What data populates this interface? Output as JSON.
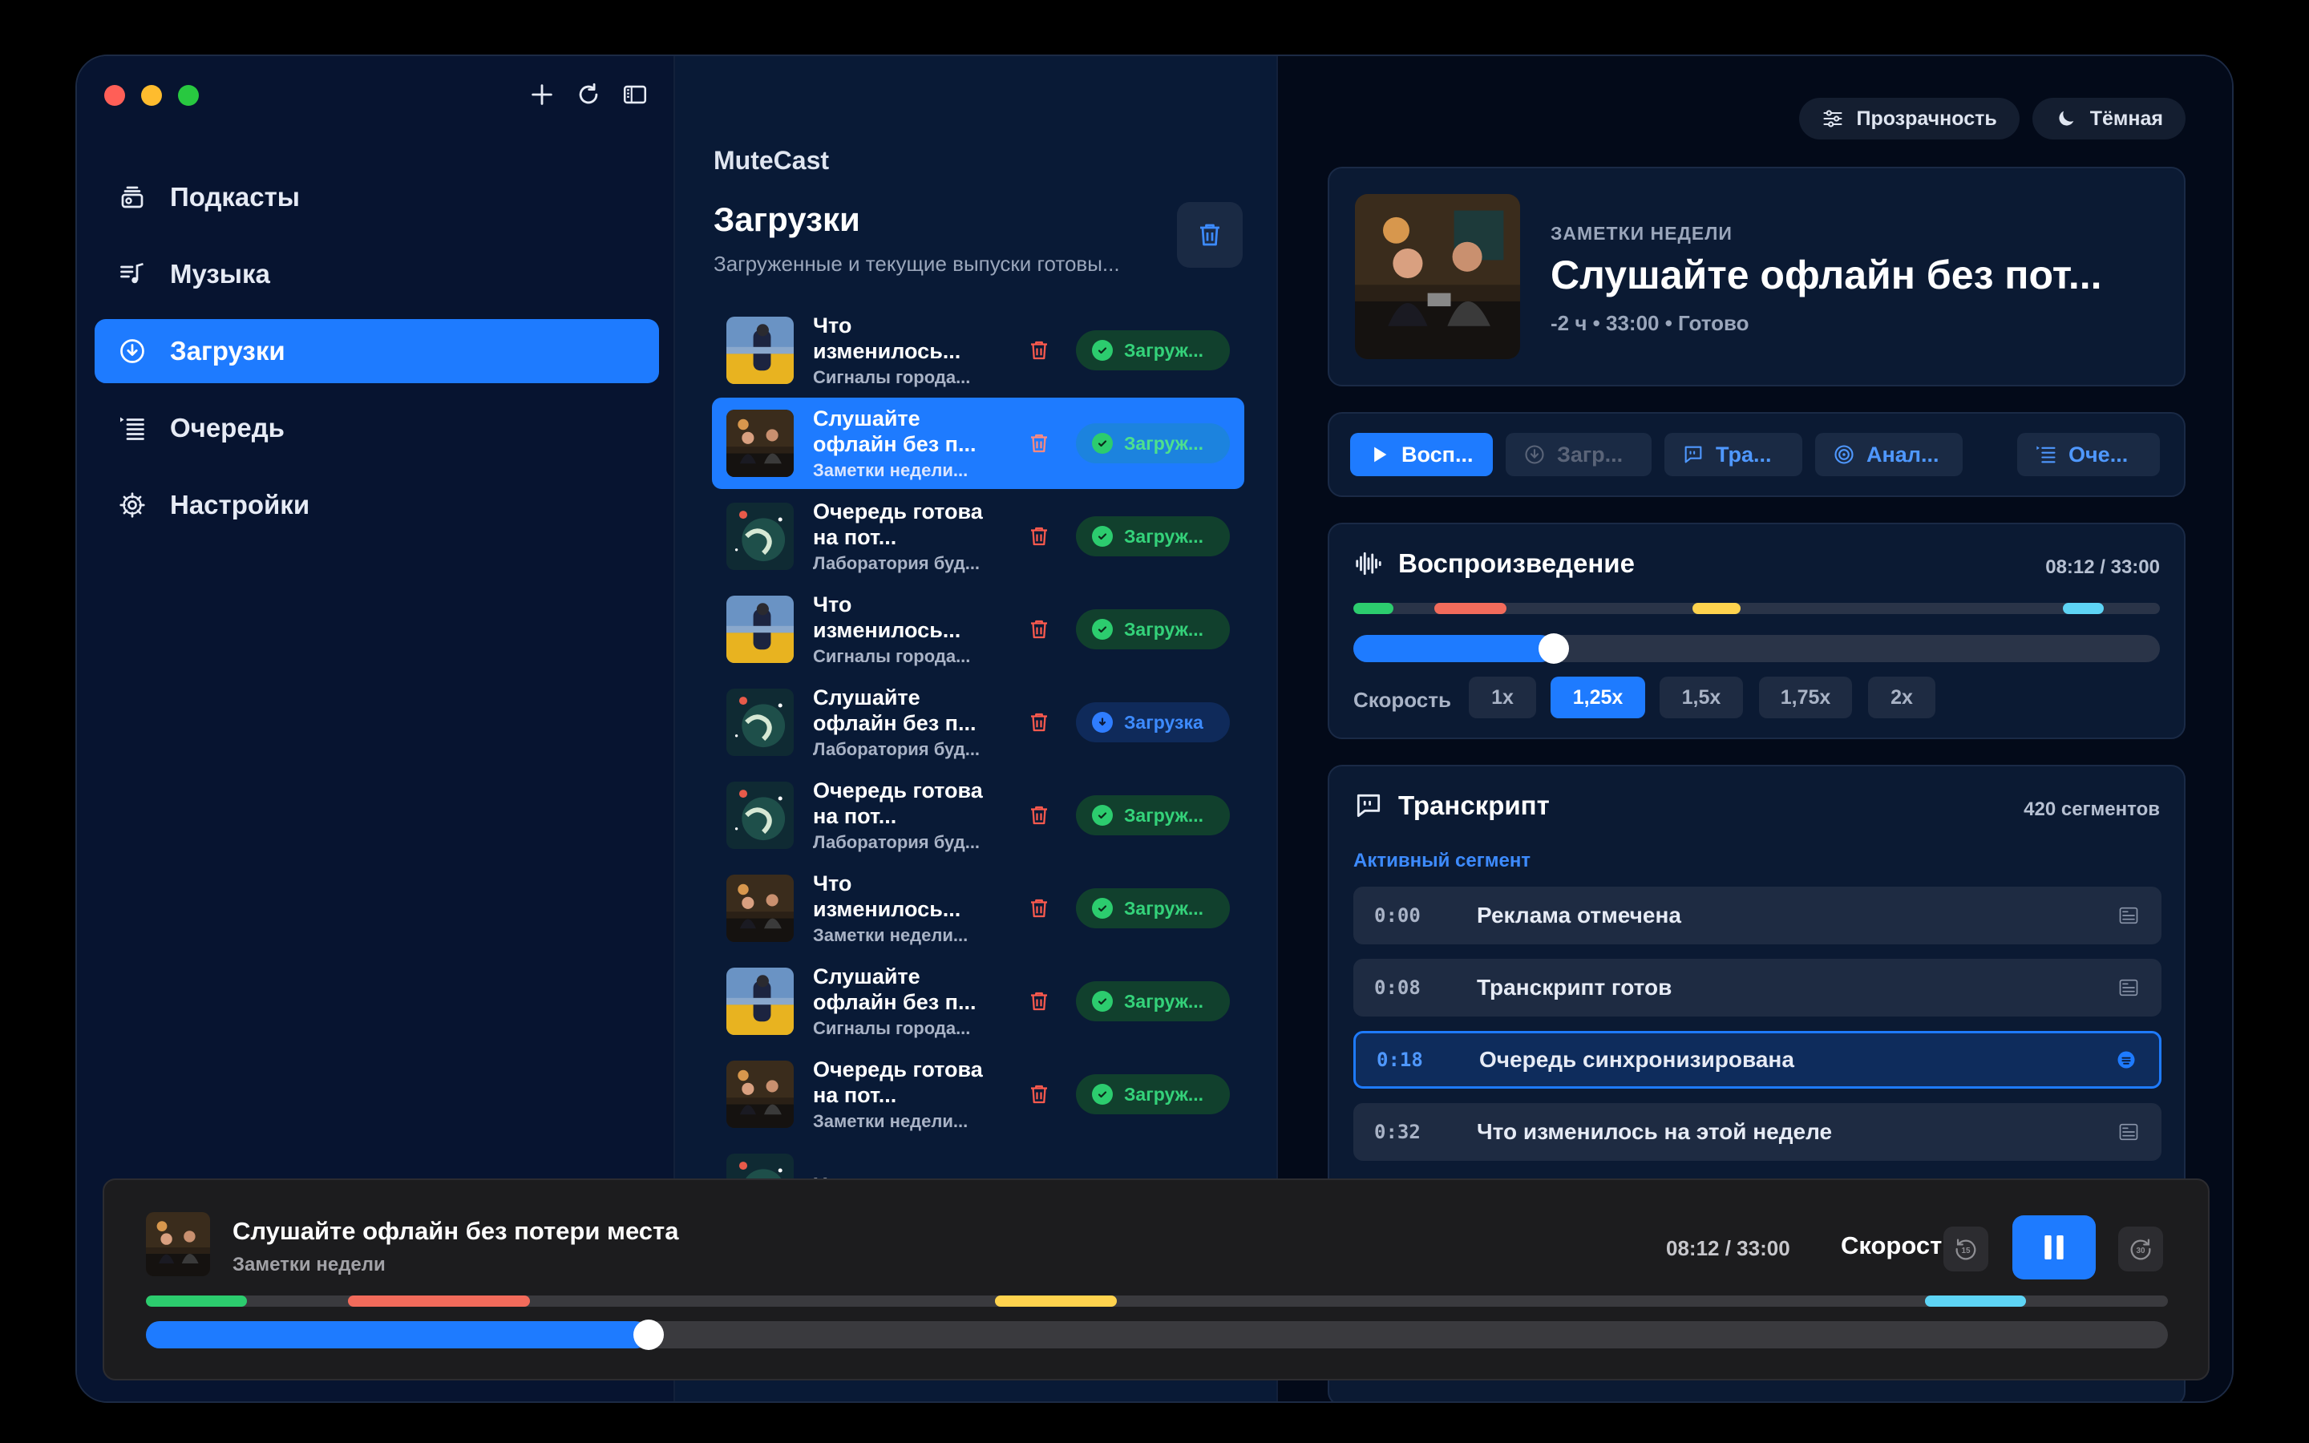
{
  "colors": {
    "accent": "#1e7bff",
    "success": "#34d27a",
    "danger": "#ff5a4e",
    "chapter_green": "#2ccc6e",
    "chapter_red": "#f26b5b",
    "chapter_yellow": "#ffd34e",
    "chapter_cyan": "#5ed4f5"
  },
  "sidebar": {
    "tools": [
      "plus-icon",
      "refresh-icon",
      "sidebar-toggle-icon"
    ],
    "items": [
      {
        "label": "Подкасты",
        "icon": "podcasts-icon",
        "active": false
      },
      {
        "label": "Музыка",
        "icon": "music-icon",
        "active": false
      },
      {
        "label": "Загрузки",
        "icon": "download-icon",
        "active": true
      },
      {
        "label": "Очередь",
        "icon": "queue-icon",
        "active": false
      },
      {
        "label": "Настройки",
        "icon": "gear-icon",
        "active": false
      }
    ]
  },
  "list": {
    "app_name": "MuteCast",
    "title": "Загрузки",
    "subtitle": "Загруженные и текущие выпуски готовы...",
    "rows": [
      {
        "title": "Что изменилось...",
        "sub": "Сигналы города...",
        "status": "Загруж...",
        "state": "done",
        "art": "city",
        "selected": false
      },
      {
        "title": "Слушайте офлайн без п...",
        "sub": "Заметки недели...",
        "status": "Загруж...",
        "state": "done",
        "art": "studio",
        "selected": true
      },
      {
        "title": "Очередь готова на пот...",
        "sub": "Лаборатория буд...",
        "status": "Загруж...",
        "state": "done",
        "art": "space",
        "selected": false
      },
      {
        "title": "Что изменилось...",
        "sub": "Сигналы города...",
        "status": "Загруж...",
        "state": "done",
        "art": "city",
        "selected": false
      },
      {
        "title": "Слушайте офлайн без п...",
        "sub": "Лаборатория буд...",
        "status": "Загрузка",
        "state": "loading",
        "art": "space",
        "selected": false
      },
      {
        "title": "Очередь готова на пот...",
        "sub": "Лаборатория буд...",
        "status": "Загруж...",
        "state": "done",
        "art": "space",
        "selected": false
      },
      {
        "title": "Что изменилось...",
        "sub": "Заметки недели...",
        "status": "Загруж...",
        "state": "done",
        "art": "studio",
        "selected": false
      },
      {
        "title": "Слушайте офлайн без п...",
        "sub": "Сигналы города...",
        "status": "Загруж...",
        "state": "done",
        "art": "city",
        "selected": false
      },
      {
        "title": "Очередь готова на пот...",
        "sub": "Заметки недели...",
        "status": "Загруж...",
        "state": "done",
        "art": "studio",
        "selected": false
      },
      {
        "title": "Что",
        "sub": "",
        "status": "",
        "state": "done",
        "art": "space",
        "selected": false
      }
    ]
  },
  "detail": {
    "chips": [
      {
        "label": "Прозрачность",
        "icon": "sliders-icon"
      },
      {
        "label": "Тёмная",
        "icon": "moon-icon"
      }
    ],
    "hero": {
      "kicker": "ЗАМЕТКИ НЕДЕЛИ",
      "title": "Слушайте офлайн без пот...",
      "meta": "-2 ч • 33:00 • Готово"
    },
    "actions": [
      {
        "label": "Восп...",
        "icon": "play-icon",
        "style": "primary"
      },
      {
        "label": "Загр...",
        "icon": "download-icon",
        "style": "disabled"
      },
      {
        "label": "Тра...",
        "icon": "transcript-icon",
        "style": "normal"
      },
      {
        "label": "Анал...",
        "icon": "analysis-icon",
        "style": "normal"
      },
      {
        "label": "Оче...",
        "icon": "queue-icon",
        "style": "normal"
      }
    ],
    "playback": {
      "title": "Воспроизведение",
      "time": "08:12 / 33:00",
      "progress": 0.2485,
      "speed_label": "Скорость",
      "speeds": [
        "1x",
        "1,25x",
        "1,5x",
        "1,75x",
        "2x"
      ],
      "speed_selected": "1,25x"
    },
    "transcript": {
      "title": "Транскрипт",
      "count": "420 сегментов",
      "active_label": "Активный сегмент",
      "segments": [
        {
          "time": "0:00",
          "text": "Реклама отмечена",
          "active": false
        },
        {
          "time": "0:08",
          "text": "Транскрипт готов",
          "active": false
        },
        {
          "time": "0:18",
          "text": "Очередь синхронизирована",
          "active": true
        },
        {
          "time": "0:32",
          "text": "Что изменилось на этой неделе",
          "active": false
        }
      ]
    }
  },
  "player": {
    "title": "Слушайте офлайн без потери места",
    "subtitle": "Заметки недели",
    "time": "08:12 / 33:00",
    "speed_label": "Скорость",
    "progress": 0.2485,
    "skip_back": "15",
    "skip_forward": "30",
    "chapters": [
      {
        "start": 0.0,
        "end": 0.05,
        "color": "#2ccc6e"
      },
      {
        "start": 0.1,
        "end": 0.19,
        "color": "#f26b5b"
      },
      {
        "start": 0.42,
        "end": 0.48,
        "color": "#ffd34e"
      },
      {
        "start": 0.88,
        "end": 0.93,
        "color": "#5ed4f5"
      }
    ]
  }
}
